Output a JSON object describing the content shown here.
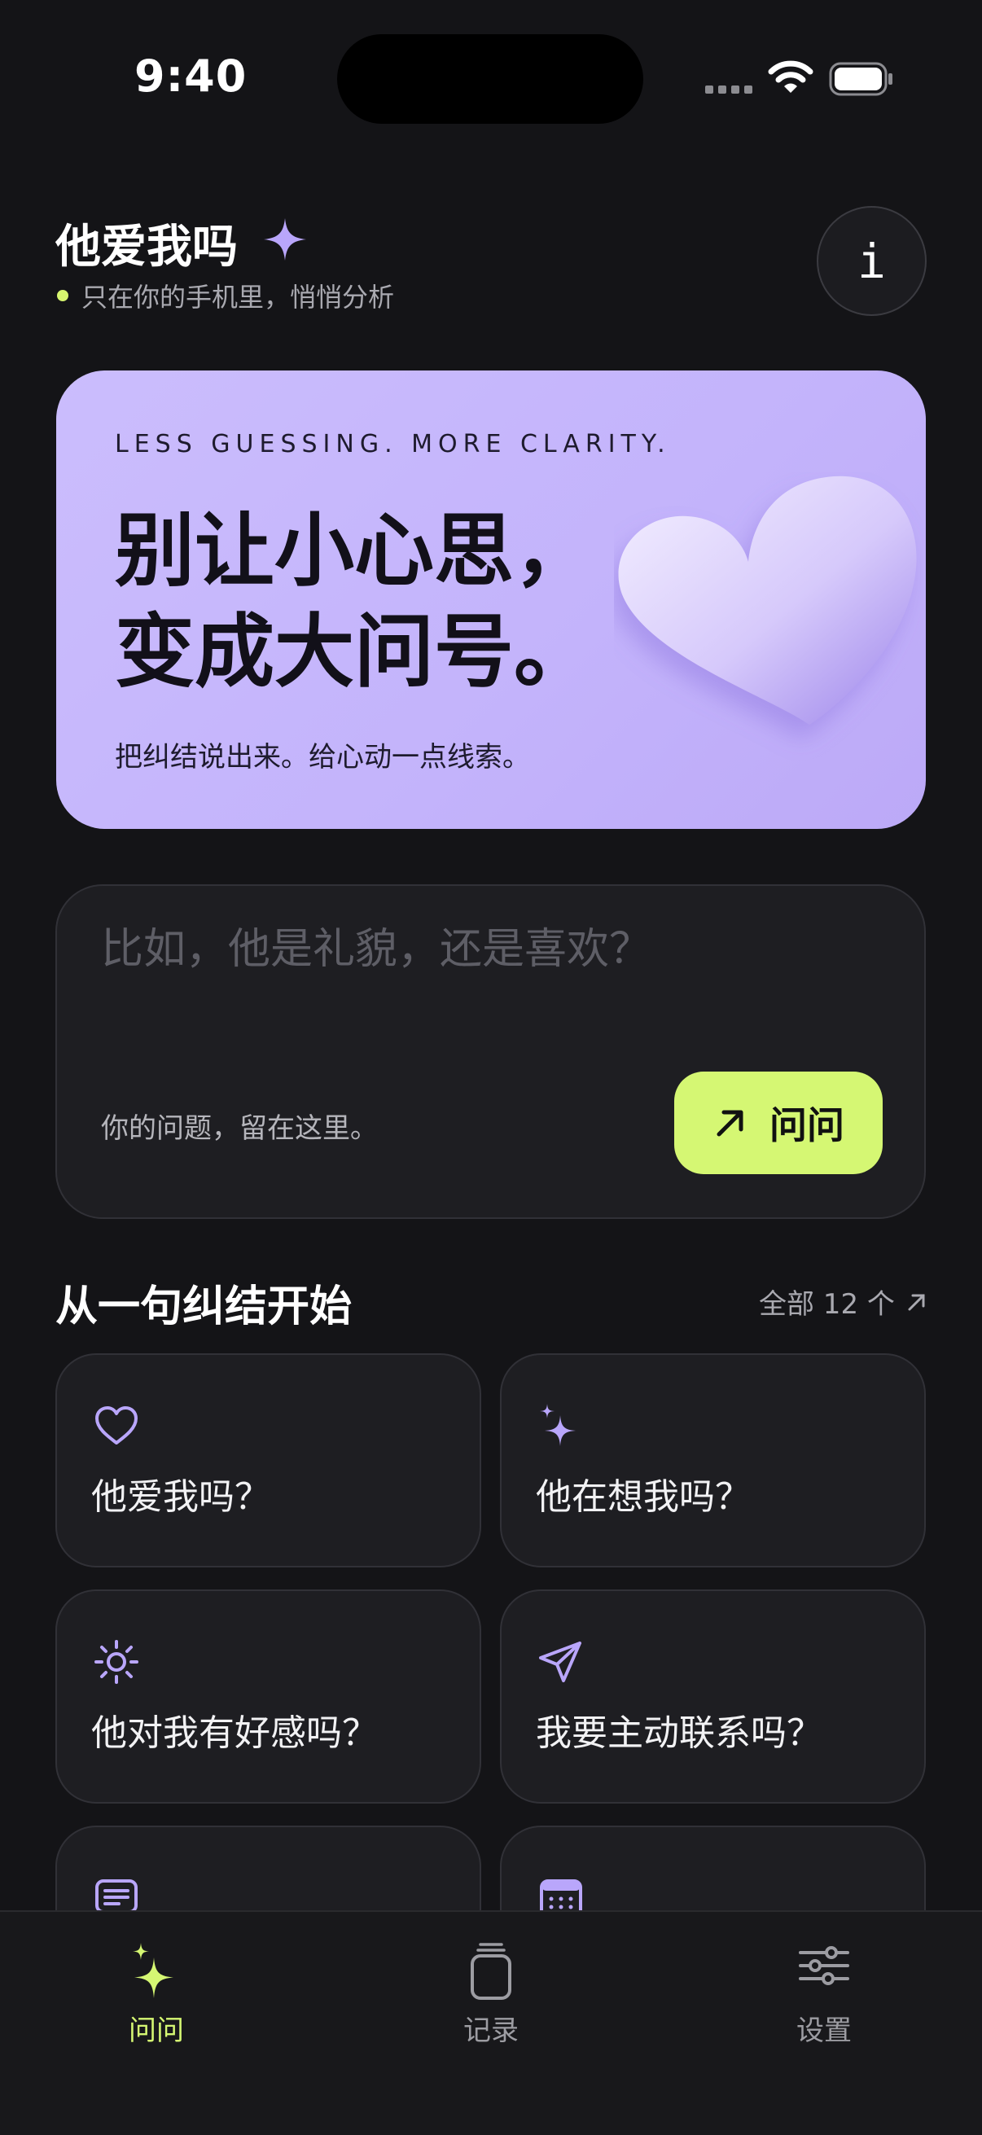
{
  "status_bar": {
    "time": "9:40"
  },
  "header": {
    "title": "他爱我吗",
    "subtitle": "只在你的手机里，悄悄分析",
    "info_label": "i"
  },
  "hero": {
    "kicker": "LESS GUESSING. MORE CLARITY.",
    "headline_line1": "别让小心思，",
    "headline_line2": "变成大问号。",
    "subtext": "把纠结说出来。给心动一点线索。"
  },
  "ask": {
    "placeholder": "比如，他是礼貌，还是喜欢？",
    "value": "",
    "hint": "你的问题，留在这里。",
    "button_label": "问问"
  },
  "questions_section": {
    "title": "从一句纠结开始",
    "see_all_label": "全部 12 个",
    "items": [
      {
        "icon": "heart-icon",
        "label": "他爱我吗？"
      },
      {
        "icon": "sparkles-icon",
        "label": "他在想我吗？"
      },
      {
        "icon": "sun-icon",
        "label": "他对我有好感吗？"
      },
      {
        "icon": "send-icon",
        "label": "我要主动联系吗？"
      },
      {
        "icon": "message-icon",
        "label": ""
      },
      {
        "icon": "calendar-icon",
        "label": ""
      }
    ]
  },
  "tab_bar": {
    "tabs": [
      {
        "label": "问问",
        "icon": "sparkles-icon",
        "active": true
      },
      {
        "label": "记录",
        "icon": "jar-icon",
        "active": false
      },
      {
        "label": "设置",
        "icon": "sliders-icon",
        "active": false
      }
    ]
  },
  "colors": {
    "background": "#141417",
    "card": "#1e1e22",
    "accent_lime": "#d5f773",
    "accent_lavender": "#c6b6fc",
    "icon_lavender": "#b9a6fb"
  }
}
